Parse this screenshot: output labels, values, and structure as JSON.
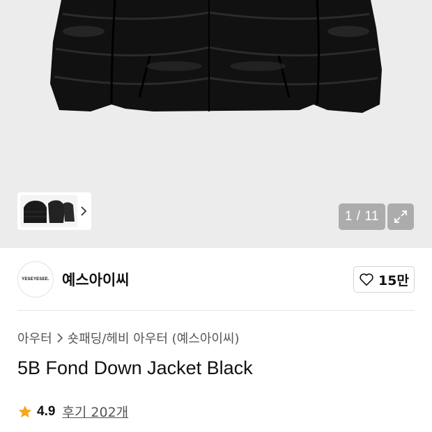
{
  "gallery": {
    "counter": "1 / 11",
    "thumbnail_icon": "jacket-thumbnail",
    "next_icon": "chevron-right-icon",
    "expand_icon": "expand-icon"
  },
  "brand": {
    "logo_text": "YESEYESEE.",
    "name": "예스아이씨",
    "like_count": "15만"
  },
  "breadcrumb": {
    "category": "아우터",
    "subcategory": "숏패딩/헤비 아우터 (예스아이씨)"
  },
  "product": {
    "title": "5B Fond Down Jacket Black"
  },
  "rating": {
    "value": "4.9",
    "reviews": "후기 202개",
    "star_color": "#f5a623"
  }
}
